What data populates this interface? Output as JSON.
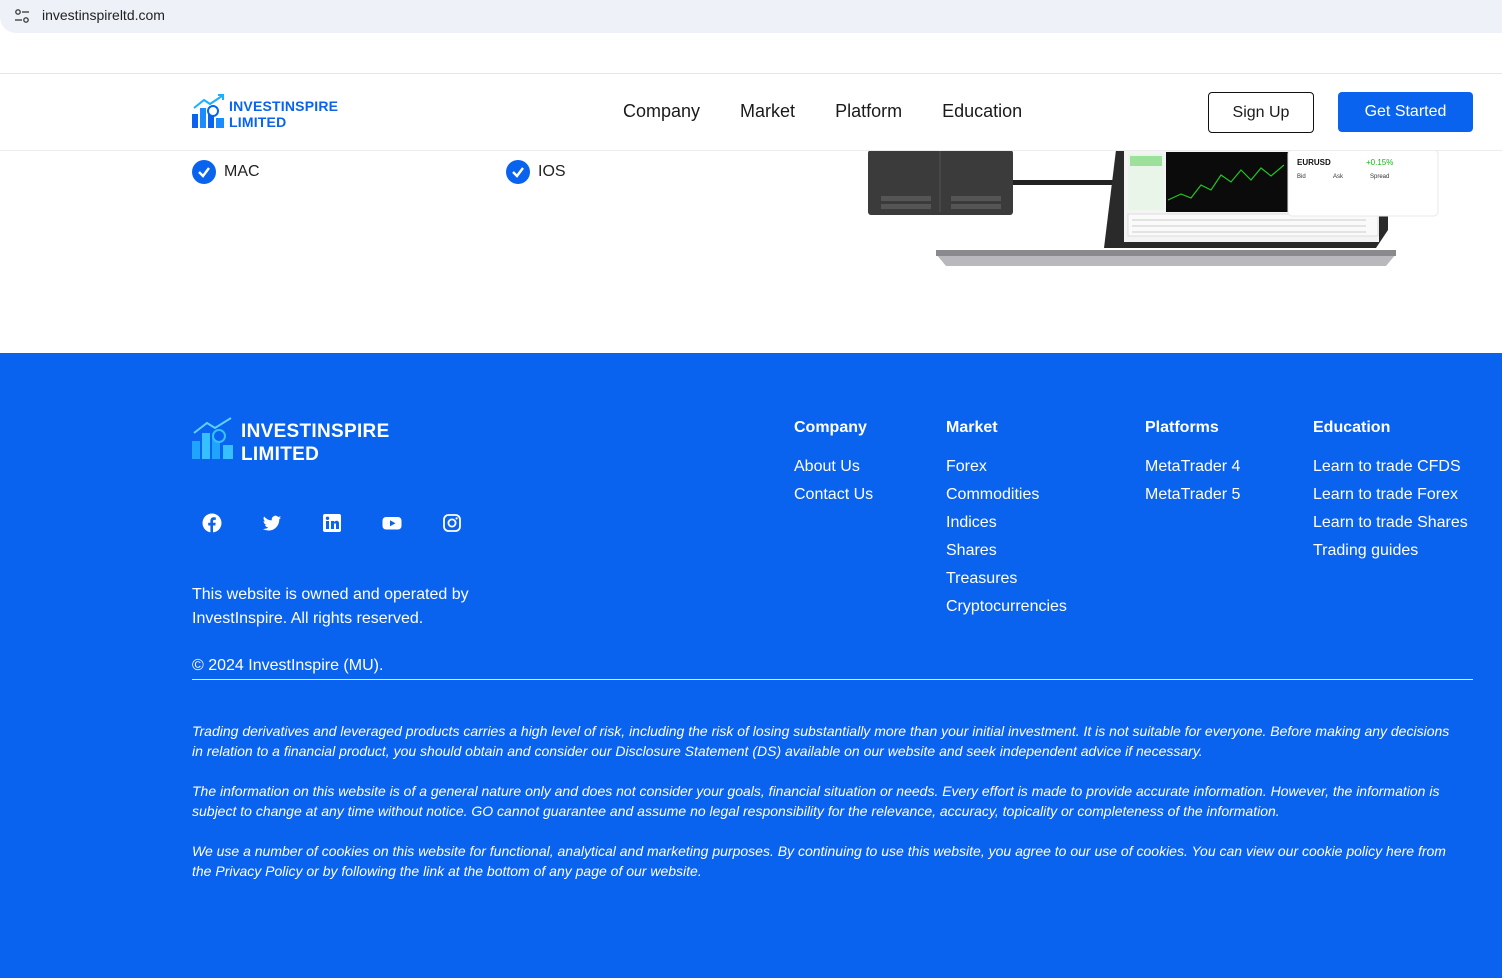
{
  "browser": {
    "url": "investinspireltd.com"
  },
  "header": {
    "logo_line1": "INVESTINSPIRE",
    "logo_line2": "LIMITED",
    "nav": [
      "Company",
      "Market",
      "Platform",
      "Education"
    ],
    "signup_label": "Sign Up",
    "get_started_label": "Get Started"
  },
  "platforms_checklist": [
    "MAC",
    "IOS"
  ],
  "ticker": {
    "symbol": "EURUSD",
    "change": "+0.15%",
    "bid_label": "Bid",
    "ask_label": "Ask",
    "spread_label": "Spread"
  },
  "footer": {
    "logo_line1": "INVESTINSPIRE",
    "logo_line2": "LIMITED",
    "socials": [
      "facebook-icon",
      "twitter-icon",
      "linkedin-icon",
      "youtube-icon",
      "instagram-icon"
    ],
    "about_text": "This website is owned and operated by InvestInspire. All rights reserved.",
    "copyright": "© 2024 InvestInspire (MU).",
    "columns": [
      {
        "title": "Company",
        "links": [
          "About Us",
          "Contact Us"
        ]
      },
      {
        "title": "Market",
        "links": [
          "Forex",
          "Commodities",
          "Indices",
          "Shares",
          "Treasures",
          "Cryptocurrencies"
        ]
      },
      {
        "title": "Platforms",
        "links": [
          "MetaTrader 4",
          "MetaTrader 5"
        ]
      },
      {
        "title": "Education",
        "links": [
          "Learn to trade CFDS",
          "Learn to trade Forex",
          "Learn to trade Shares",
          "Trading guides"
        ]
      }
    ],
    "disclaimers": [
      "Trading derivatives and leveraged products carries a high level of risk, including the risk of losing substantially more than your initial investment. It is not suitable for everyone. Before making any decisions in relation to a financial product, you should obtain and consider our Disclosure Statement (DS) available on our website and seek independent advice if necessary.",
      "The information on this website is of a general nature only and does not consider your goals, financial situation or needs. Every effort is made to provide accurate information. However, the information is subject to change at any time without notice. GO cannot guarantee and assume no legal responsibility for the relevance, accuracy, topicality or completeness of the information.",
      "We use a number of cookies on this website for functional, analytical and marketing purposes. By continuing to use this website, you agree to our use of cookies. You can view our cookie policy here from the Privacy Policy or by following the link at the bottom of any page of our website."
    ]
  },
  "colors": {
    "brand": "#0a63ef"
  }
}
